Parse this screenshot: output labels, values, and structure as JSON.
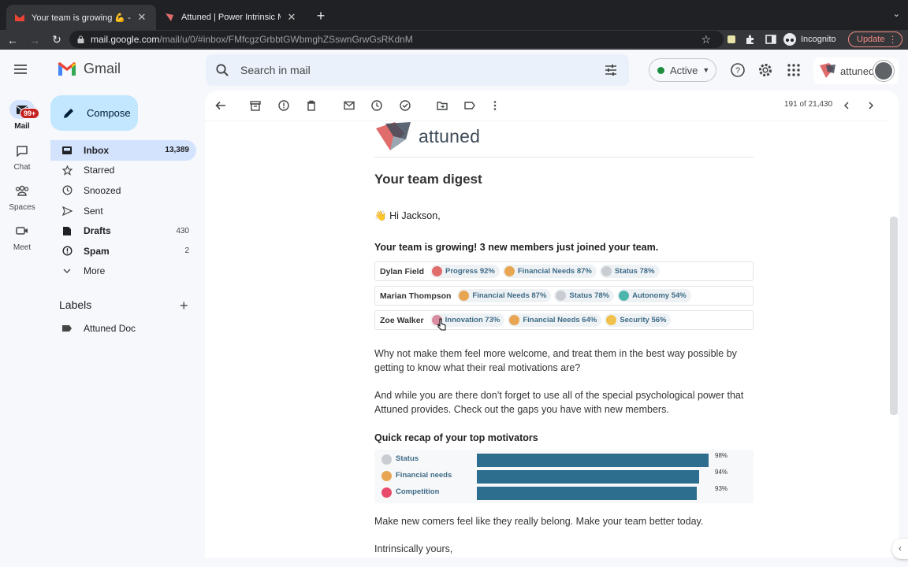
{
  "browser": {
    "tabs": [
      {
        "title": "Your team is growing 💪 - amn",
        "active": true
      },
      {
        "title": "Attuned | Power Intrinsic Motiv",
        "active": false
      }
    ],
    "url_host": "mail.google.com",
    "url_path": "/mail/u/0/#inbox/FMfcgzGrbbtGWbmghZSswnGrwGsRKdnM",
    "incognito_label": "Incognito",
    "update_label": "Update"
  },
  "gmail": {
    "product_name": "Gmail",
    "search_placeholder": "Search in mail",
    "status_label": "Active",
    "account_brand": "attuned"
  },
  "rail": [
    {
      "label": "Mail",
      "badge": "99+",
      "icon": "mail-icon"
    },
    {
      "label": "Chat",
      "icon": "chat-icon"
    },
    {
      "label": "Spaces",
      "icon": "spaces-icon"
    },
    {
      "label": "Meet",
      "icon": "meet-icon"
    }
  ],
  "compose_label": "Compose",
  "nav": [
    {
      "label": "Inbox",
      "count": "13,389",
      "icon": "inbox-icon"
    },
    {
      "label": "Starred",
      "count": "",
      "icon": "star-icon"
    },
    {
      "label": "Snoozed",
      "count": "",
      "icon": "clock-icon"
    },
    {
      "label": "Sent",
      "count": "",
      "icon": "send-icon"
    },
    {
      "label": "Drafts",
      "count": "430",
      "icon": "draft-icon"
    },
    {
      "label": "Spam",
      "count": "2",
      "icon": "spam-icon"
    },
    {
      "label": "More",
      "count": "",
      "icon": "chevron-down-icon"
    }
  ],
  "labels": {
    "heading": "Labels",
    "items": [
      "Attuned Doc"
    ]
  },
  "toolbar": {
    "pager": "191 of 21,430"
  },
  "email": {
    "brand": "attuned",
    "title": "Your team digest",
    "greeting": "Hi Jackson,",
    "headline": "Your team is growing! 3 new members just joined your team.",
    "members": [
      {
        "name": "Dylan Field",
        "chips": [
          {
            "label": "Progress 92%",
            "color": "#e06c6c"
          },
          {
            "label": "Financial Needs 87%",
            "color": "#e8a552"
          },
          {
            "label": "Status 78%",
            "color": "#c9cdd2"
          }
        ]
      },
      {
        "name": "Marian Thompson",
        "chips": [
          {
            "label": "Financial Needs 87%",
            "color": "#e8a552"
          },
          {
            "label": "Status 78%",
            "color": "#c9cdd2"
          },
          {
            "label": "Autonomy 54%",
            "color": "#4db6ac"
          }
        ]
      },
      {
        "name": "Zoe Walker",
        "chips": [
          {
            "label": "Innovation 73%",
            "color": "#d98ca0"
          },
          {
            "label": "Financial Needs 64%",
            "color": "#e8a552"
          },
          {
            "label": "Security 56%",
            "color": "#f0c14b"
          }
        ]
      }
    ],
    "para1": "Why not make them feel more welcome, and treat them in the best way possible by getting to know what their real motivations are?",
    "para2": "And while you are there don’t forget to use all of the special psychological power that Attuned provides. Check out the gaps you have with new members.",
    "recap_title": "Quick recap of your top motivators",
    "motivators": [
      {
        "label": "Status",
        "value": 98,
        "pct": "98%",
        "color": "#c9cdd2"
      },
      {
        "label": "Financial needs",
        "value": 94,
        "pct": "94%",
        "color": "#e8a552"
      },
      {
        "label": "Competition",
        "value": 93,
        "pct": "93%",
        "color": "#e84a6c"
      }
    ],
    "para3": "Make new comers feel like they really belong. Make your team better today.",
    "signoff": "Intrinsically yours,"
  }
}
